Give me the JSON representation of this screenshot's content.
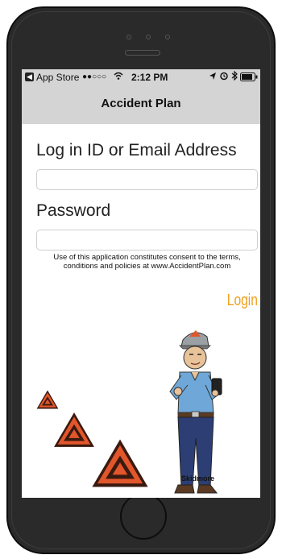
{
  "status_bar": {
    "back_label": "App Store",
    "signal": "●●○○○",
    "time": "2:12 PM"
  },
  "nav": {
    "title": "Accident Plan"
  },
  "login_form": {
    "id_label": "Log in ID or Email Address",
    "id_value": "",
    "password_label": "Password",
    "password_value": "",
    "consent_text": "Use of this application constitutes consent to the terms, conditions and policies at www.AccidentPlan.com",
    "login_label": "Login"
  },
  "mascot": {
    "name": "Skidmore"
  },
  "colors": {
    "accent": "#f0a01e",
    "sign_fill": "#e2562b",
    "sign_dark": "#3a1a10",
    "nav_bg": "#d4d4d4"
  }
}
